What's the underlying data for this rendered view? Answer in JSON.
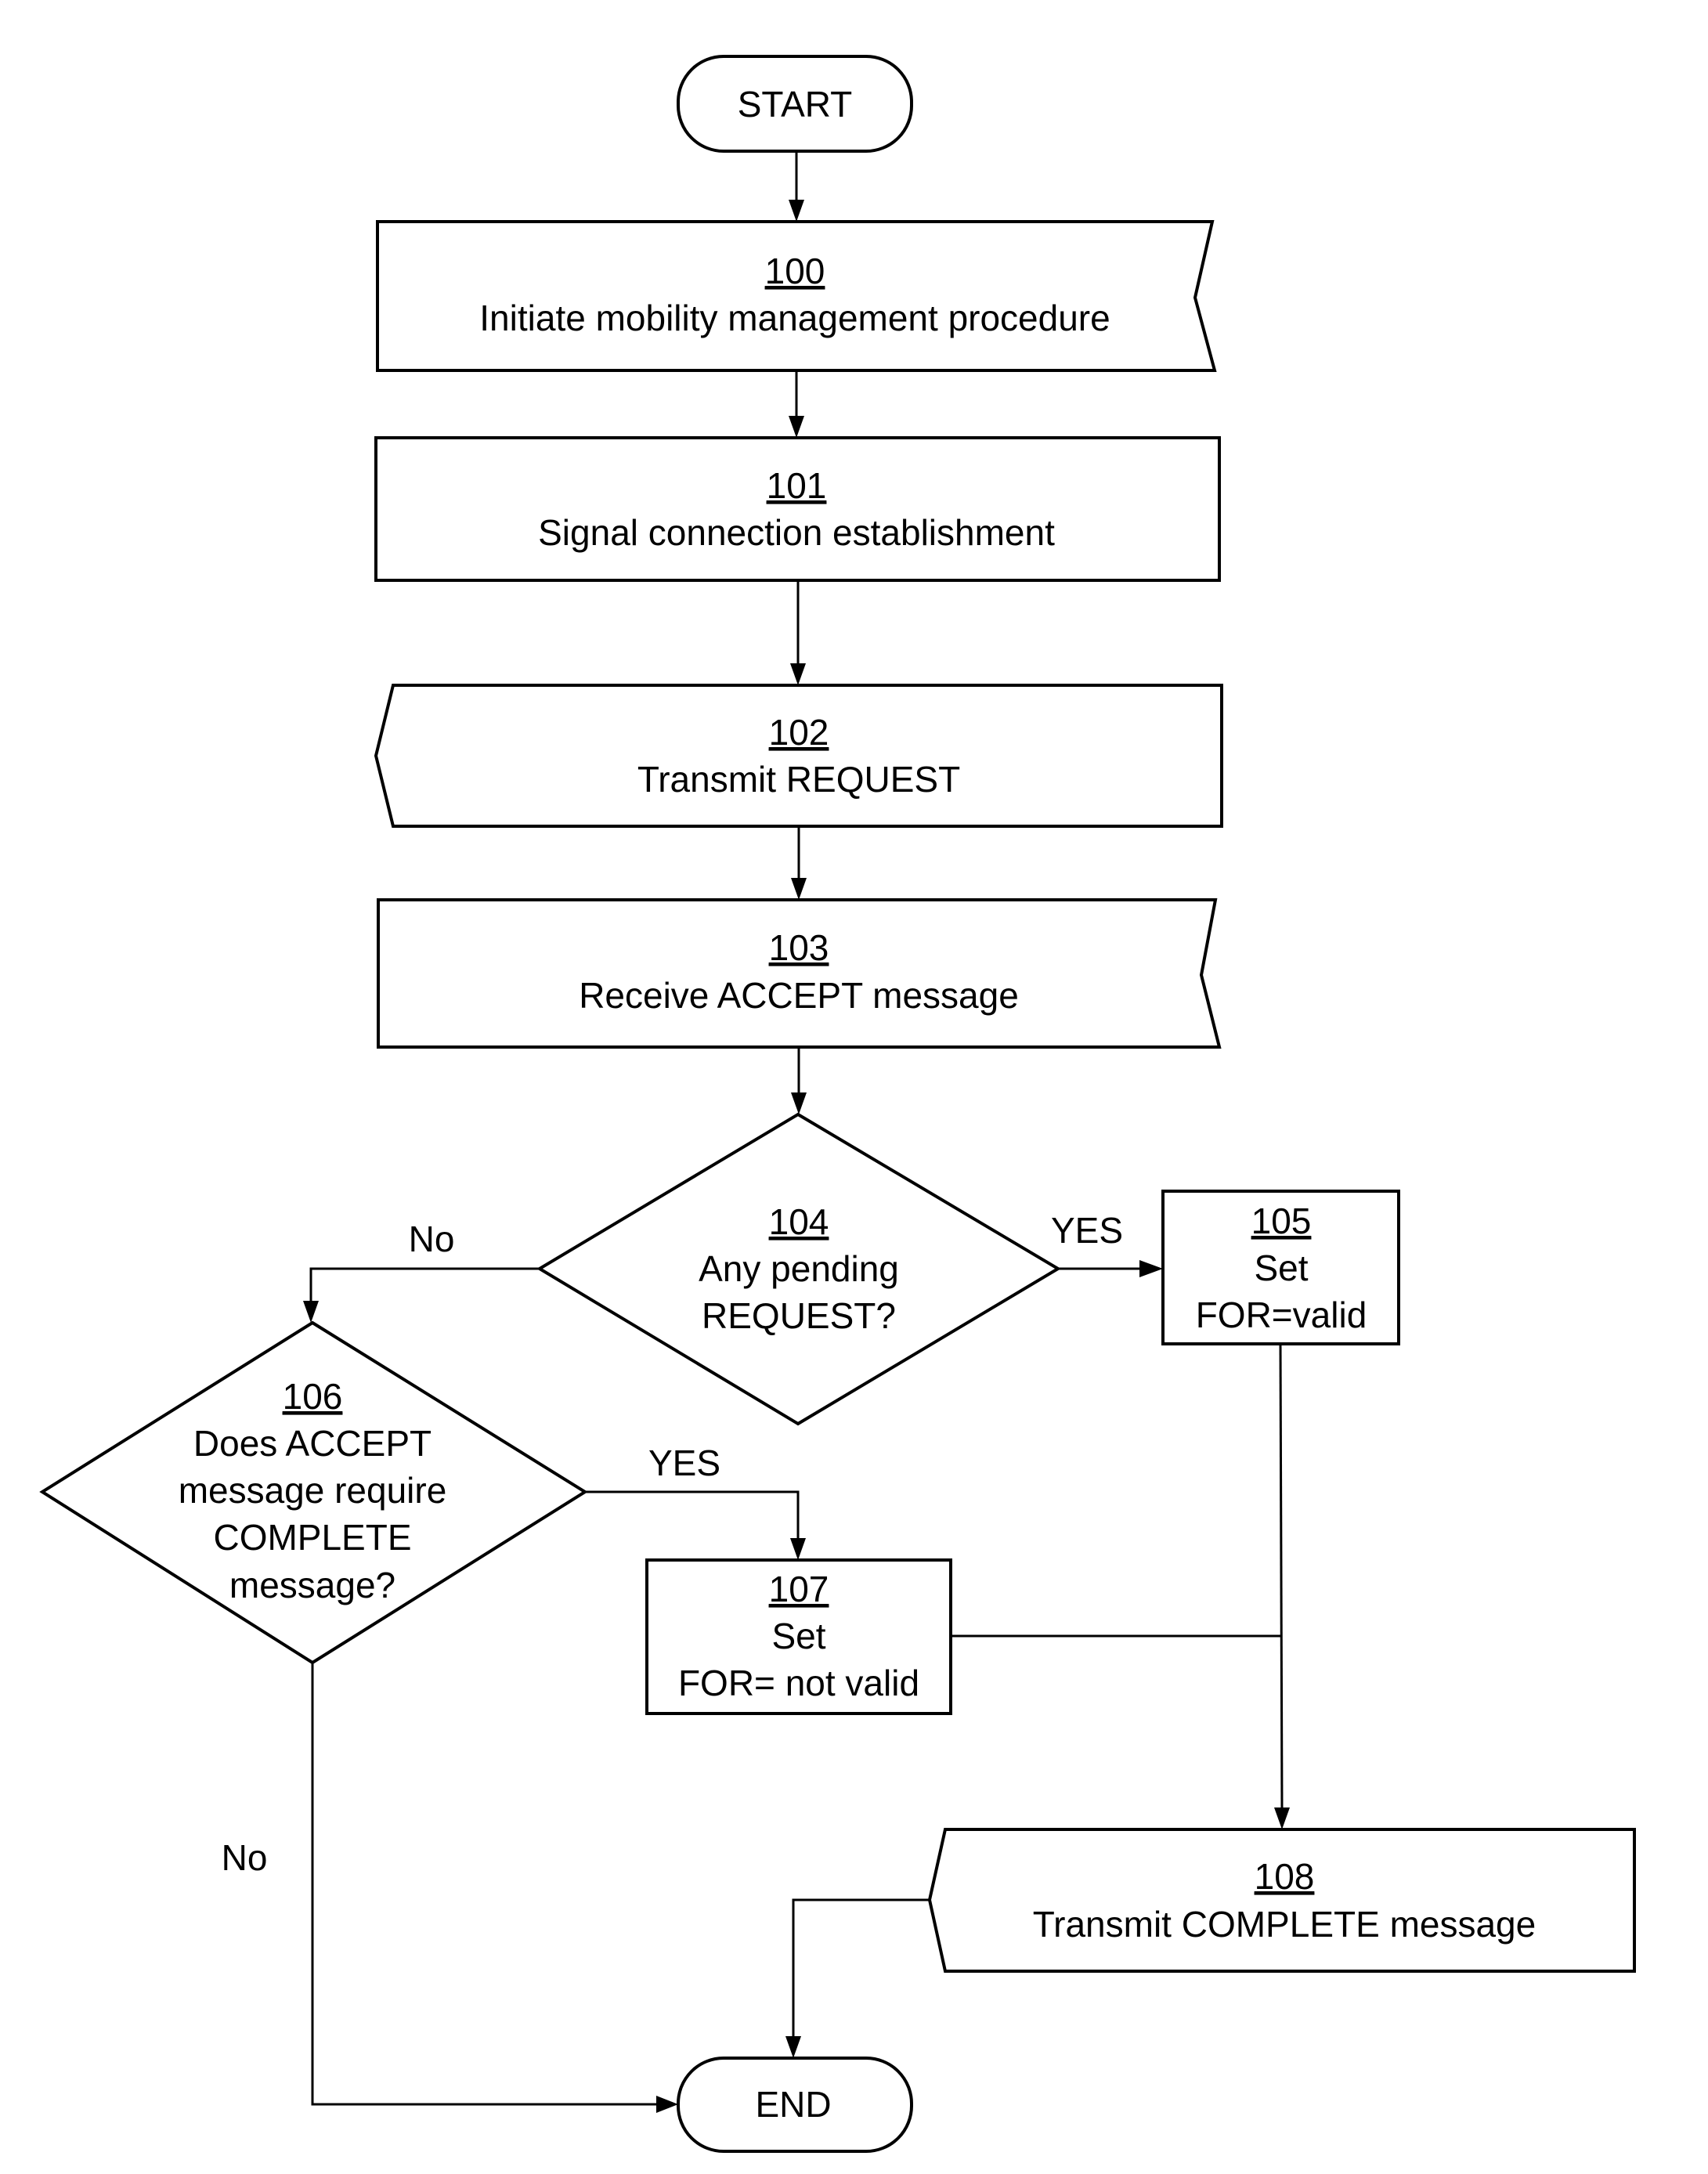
{
  "diagram": {
    "type": "flowchart",
    "nodes": [
      {
        "id": "start",
        "shape": "terminator",
        "lines": [
          "START"
        ]
      },
      {
        "id": "100",
        "shape": "process-wavy-right",
        "number": "100",
        "lines": [
          "Initiate mobility management procedure"
        ]
      },
      {
        "id": "101",
        "shape": "process",
        "number": "101",
        "lines": [
          "Signal connection establishment"
        ]
      },
      {
        "id": "102",
        "shape": "send-notched-left",
        "number": "102",
        "lines": [
          "Transmit REQUEST"
        ]
      },
      {
        "id": "103",
        "shape": "process-wavy-right",
        "number": "103",
        "lines": [
          "Receive ACCEPT message"
        ]
      },
      {
        "id": "104",
        "shape": "decision",
        "number": "104",
        "lines": [
          "Any pending",
          "REQUEST?"
        ]
      },
      {
        "id": "105",
        "shape": "process",
        "number": "105",
        "lines": [
          "Set",
          "FOR=valid"
        ]
      },
      {
        "id": "106",
        "shape": "decision",
        "number": "106",
        "lines": [
          "Does ACCEPT",
          "message require",
          "COMPLETE",
          "message?"
        ]
      },
      {
        "id": "107",
        "shape": "process",
        "number": "107",
        "lines": [
          "Set",
          "FOR= not valid"
        ]
      },
      {
        "id": "108",
        "shape": "send-notched-left",
        "number": "108",
        "lines": [
          "Transmit COMPLETE message"
        ]
      },
      {
        "id": "end",
        "shape": "terminator",
        "lines": [
          "END"
        ]
      }
    ],
    "edges": [
      {
        "from": "start",
        "to": "100",
        "label": ""
      },
      {
        "from": "100",
        "to": "101",
        "label": ""
      },
      {
        "from": "101",
        "to": "102",
        "label": ""
      },
      {
        "from": "102",
        "to": "103",
        "label": ""
      },
      {
        "from": "103",
        "to": "104",
        "label": ""
      },
      {
        "from": "104",
        "to": "105",
        "label": "YES"
      },
      {
        "from": "104",
        "to": "106",
        "label": "No"
      },
      {
        "from": "106",
        "to": "107",
        "label": "YES"
      },
      {
        "from": "106",
        "to": "end",
        "label": "No"
      },
      {
        "from": "105",
        "to": "108",
        "label": ""
      },
      {
        "from": "107",
        "to": "108",
        "label": ""
      },
      {
        "from": "108",
        "to": "end",
        "label": ""
      }
    ]
  }
}
